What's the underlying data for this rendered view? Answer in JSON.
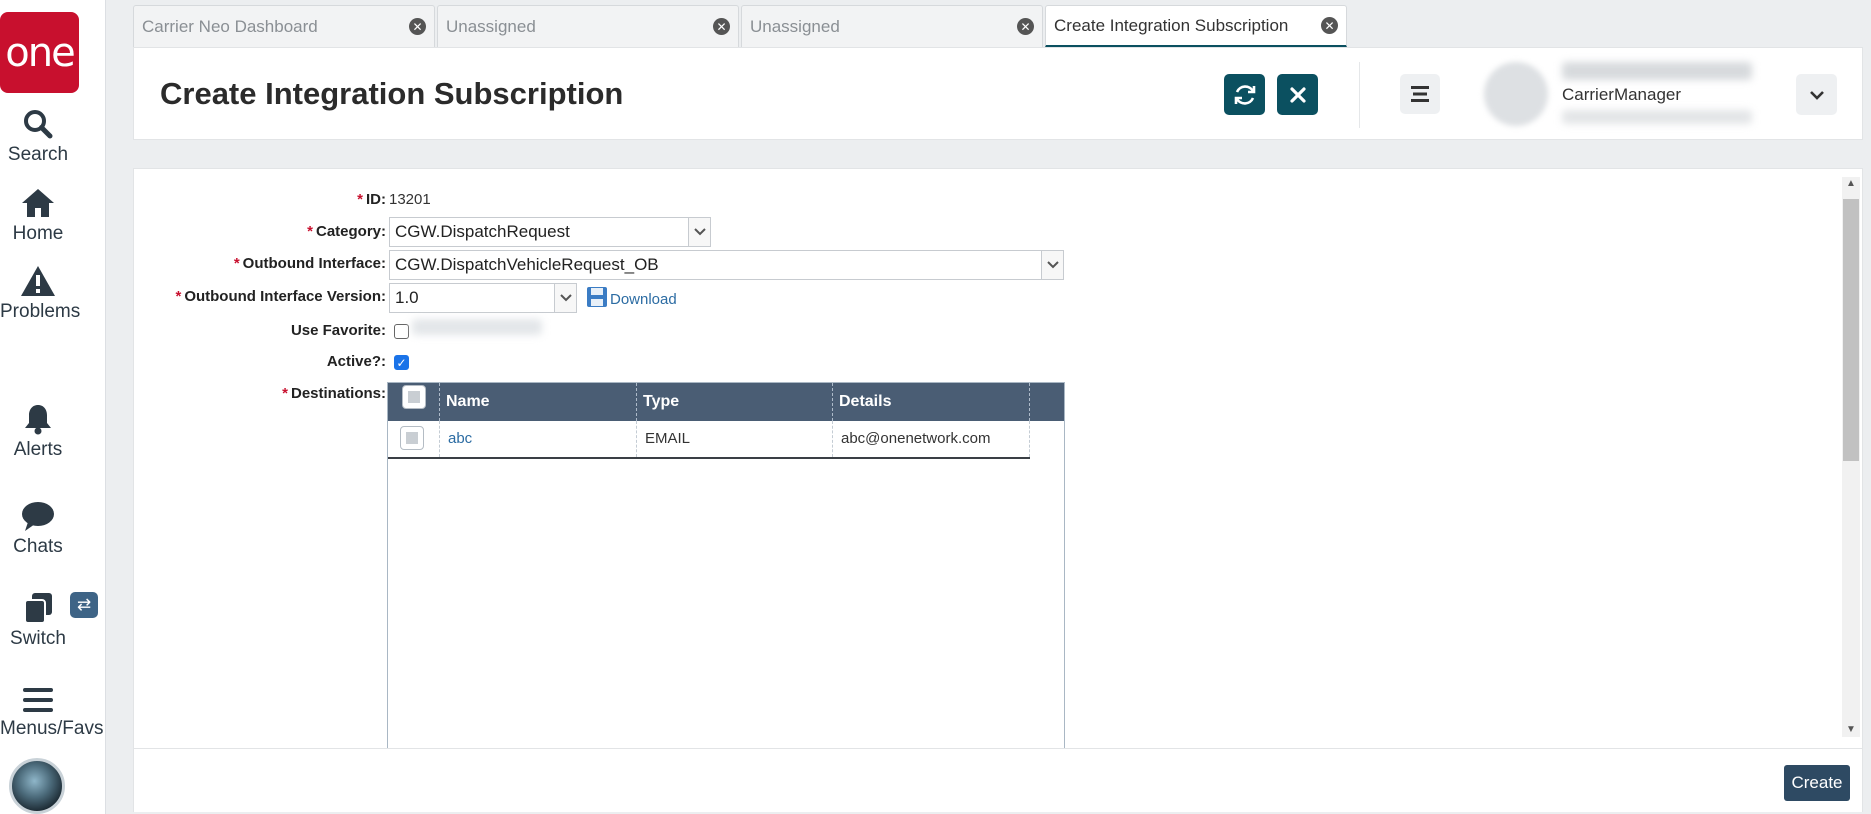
{
  "nav": {
    "logo": "one",
    "items": [
      {
        "label": "Search",
        "icon": "search-icon"
      },
      {
        "label": "Home",
        "icon": "home-icon"
      },
      {
        "label": "Problems",
        "icon": "warning-icon"
      },
      {
        "label": "Alerts",
        "icon": "bell-icon"
      },
      {
        "label": "Chats",
        "icon": "chat-icon"
      },
      {
        "label": "Switch",
        "icon": "switch-icon"
      },
      {
        "label": "Menus/Favs",
        "icon": "menu-icon"
      }
    ],
    "switch_badge": "⇄"
  },
  "tabs": [
    {
      "label": "Carrier Neo Dashboard",
      "active": false
    },
    {
      "label": "Unassigned",
      "active": false
    },
    {
      "label": "Unassigned",
      "active": false
    },
    {
      "label": "Create Integration Subscription",
      "active": true
    }
  ],
  "header": {
    "title": "Create Integration Subscription",
    "user_role": "CarrierManager"
  },
  "form": {
    "id_label": "ID:",
    "id_value": "13201",
    "category_label": "Category:",
    "category_value": "CGW.DispatchRequest",
    "outbound_interface_label": "Outbound Interface:",
    "outbound_interface_value": "CGW.DispatchVehicleRequest_OB",
    "outbound_version_label": "Outbound Interface Version:",
    "outbound_version_value": "1.0",
    "download_label": "Download",
    "use_favorite_label": "Use Favorite:",
    "use_favorite_checked": false,
    "active_label": "Active?:",
    "active_checked": true,
    "destinations_label": "Destinations:",
    "required_mark": "*"
  },
  "destinations": {
    "columns": [
      "Name",
      "Type",
      "Details"
    ],
    "rows": [
      {
        "name": "abc",
        "type": "EMAIL",
        "details": "abc@onenetwork.com"
      }
    ]
  },
  "footer": {
    "create_label": "Create"
  },
  "colors": {
    "brand_red": "#c8102e",
    "header_button": "#0b5060",
    "grid_header": "#4a5d74",
    "create_button": "#2e4a63",
    "link": "#2c6ca3"
  }
}
